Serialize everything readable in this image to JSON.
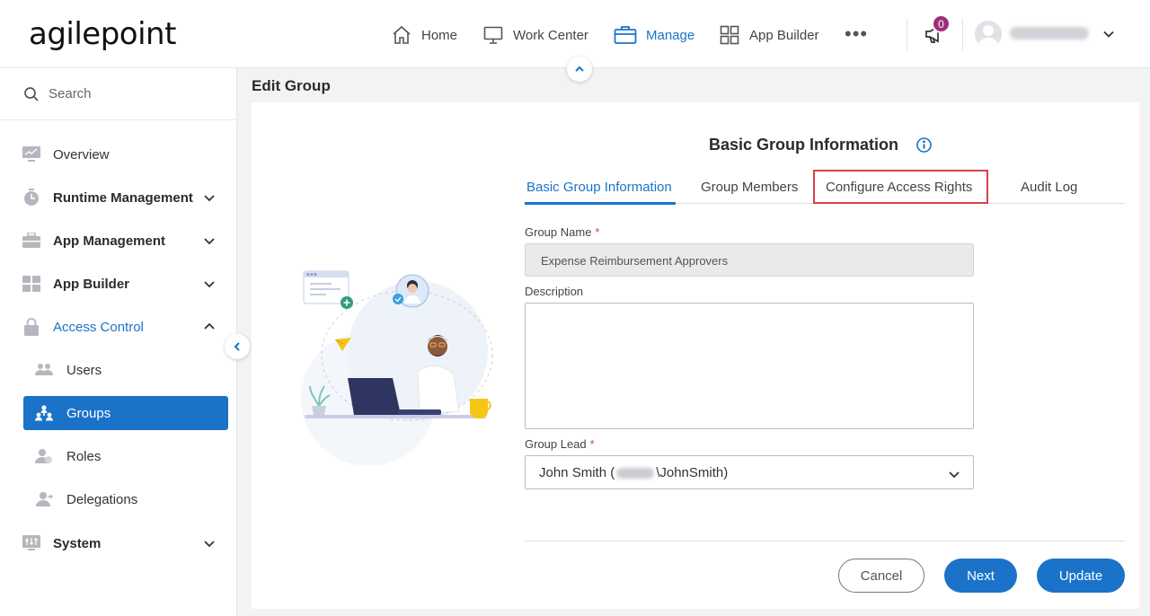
{
  "header": {
    "logo": "agilepoint",
    "nav": [
      {
        "label": "Home",
        "icon": "home-icon"
      },
      {
        "label": "Work Center",
        "icon": "monitor-icon"
      },
      {
        "label": "Manage",
        "icon": "briefcase-icon",
        "active": true
      },
      {
        "label": "App Builder",
        "icon": "grid-icon"
      }
    ],
    "more": "•••",
    "notifications": {
      "count": "0",
      "icon": "megaphone-icon"
    }
  },
  "sidebar": {
    "search_label": "Search",
    "items": [
      {
        "label": "Overview"
      },
      {
        "label": "Runtime Management"
      },
      {
        "label": "App Management"
      },
      {
        "label": "App Builder"
      },
      {
        "label": "Access Control"
      },
      {
        "label": "Users"
      },
      {
        "label": "Groups"
      },
      {
        "label": "Roles"
      },
      {
        "label": "Delegations"
      },
      {
        "label": "System"
      }
    ]
  },
  "page": {
    "title": "Edit Group",
    "form_title": "Basic Group Information",
    "tabs": [
      {
        "label": "Basic Group Information"
      },
      {
        "label": "Group Members"
      },
      {
        "label": "Configure Access Rights"
      },
      {
        "label": "Audit Log"
      }
    ],
    "fields": {
      "group_name_label": "Group Name",
      "group_name_value": "Expense Reimbursement Approvers",
      "description_label": "Description",
      "description_value": "",
      "group_lead_label": "Group Lead",
      "group_lead_prefix": "John Smith (",
      "group_lead_suffix": "\\JohnSmith)",
      "required_mark": "*"
    },
    "buttons": {
      "cancel": "Cancel",
      "next": "Next",
      "update": "Update"
    }
  },
  "colors": {
    "accent": "#1a73c9",
    "required": "#d9414b",
    "badge": "#9c2f7a",
    "highlight": "#d9414b"
  }
}
